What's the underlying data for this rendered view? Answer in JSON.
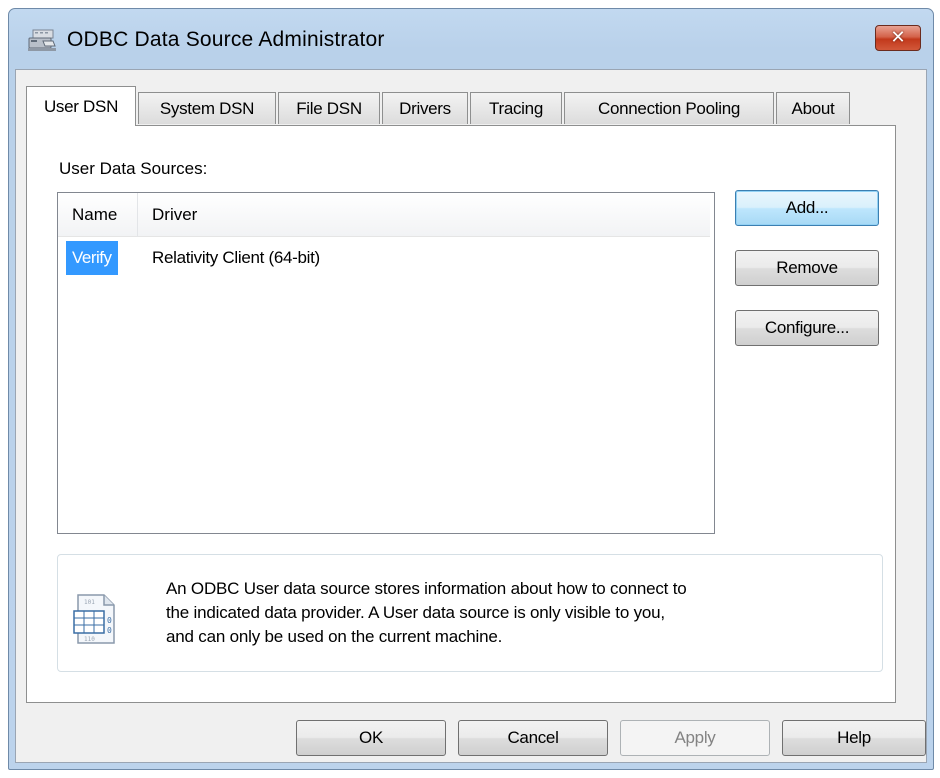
{
  "window": {
    "title": "ODBC Data Source Administrator",
    "close_glyph": "✕",
    "icon": "odbc-admin-icon"
  },
  "tabs": [
    {
      "label": "User DSN",
      "active": true
    },
    {
      "label": "System DSN",
      "active": false
    },
    {
      "label": "File DSN",
      "active": false
    },
    {
      "label": "Drivers",
      "active": false
    },
    {
      "label": "Tracing",
      "active": false
    },
    {
      "label": "Connection Pooling",
      "active": false
    },
    {
      "label": "About",
      "active": false
    }
  ],
  "user_dsn": {
    "group_label": "User Data Sources:",
    "columns": {
      "name": "Name",
      "driver": "Driver"
    },
    "rows": [
      {
        "name": "Verify",
        "driver": "Relativity Client (64-bit)",
        "selected": true
      }
    ],
    "buttons": {
      "add": "Add...",
      "remove": "Remove",
      "configure": "Configure..."
    },
    "info": {
      "icon": "data-source-info-icon",
      "text": "An ODBC User data source stores information about how to connect to\nthe indicated data provider.   A User data source is only visible to you,\nand can only be used on the current machine."
    }
  },
  "footer": {
    "ok": "OK",
    "cancel": "Cancel",
    "apply": "Apply",
    "help": "Help"
  },
  "colors": {
    "selection": "#3399ff",
    "titlebar": "#bcd3ec",
    "close": "#c2391c"
  }
}
